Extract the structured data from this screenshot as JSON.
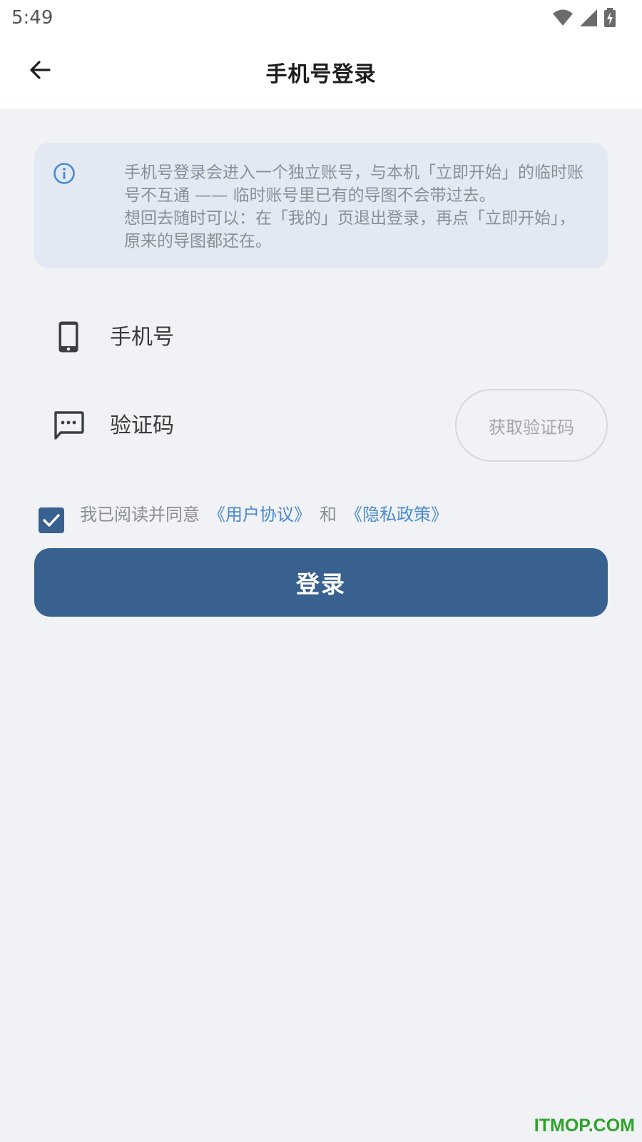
{
  "status_bar": {
    "time": "5:49",
    "icons": [
      "wifi-icon",
      "signal-icon",
      "battery-charging-icon"
    ]
  },
  "app_bar": {
    "title": "手机号登录",
    "back_icon": "arrow-left-icon"
  },
  "notice": {
    "icon": "info-icon",
    "line1": "手机号登录会进入一个独立账号，与本机「立即开始」的临时账号不互通 —— 临时账号里已有的导图不会带过去。",
    "line2": "想回去随时可以：在「我的」页退出登录，再点「立即开始」，原来的导图都还在。"
  },
  "phone_field": {
    "icon": "smartphone-icon",
    "placeholder": "手机号",
    "value": ""
  },
  "code_field": {
    "icon": "message-dots-icon",
    "placeholder": "验证码",
    "value": "",
    "button_label": "获取验证码"
  },
  "agreement": {
    "checked": true,
    "prefix": "我已阅读并同意",
    "user_agreement": "《用户协议》",
    "and": "和",
    "privacy_policy": "《隐私政策》"
  },
  "login_button": {
    "label": "登录"
  },
  "watermark": "ITMOP.COM",
  "colors": {
    "primary": "#38618f",
    "link": "#4a8ad0",
    "background": "#f0f2f5",
    "notice_bg": "#e2e9f2",
    "watermark": "#2fa32a"
  }
}
